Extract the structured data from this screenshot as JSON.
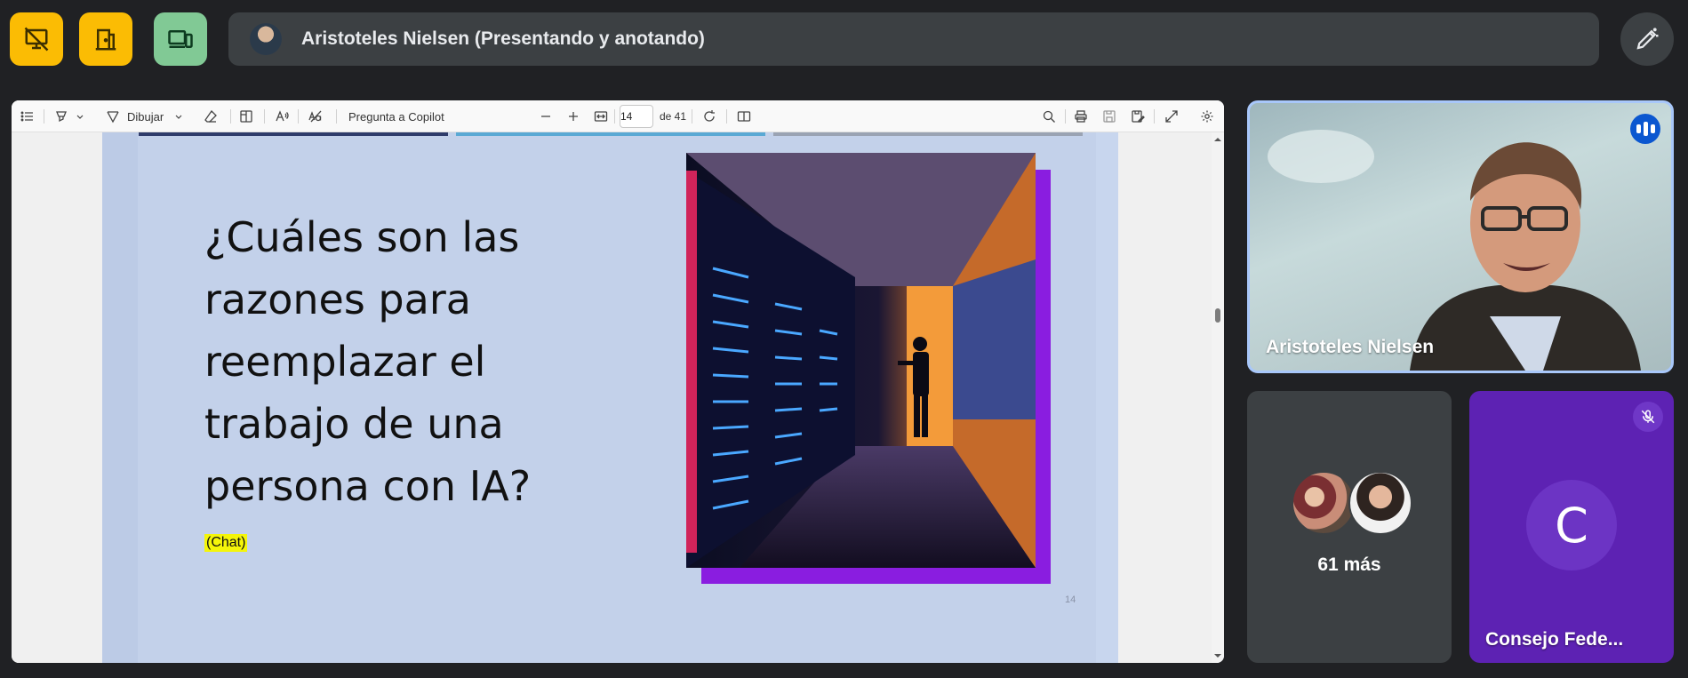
{
  "top_controls": [
    {
      "name": "stop-presenting",
      "color": "#fbbc04"
    },
    {
      "name": "leave-presentation",
      "color": "#fbbc04"
    },
    {
      "name": "switch-device",
      "color": "#81c995"
    }
  ],
  "presenter_bar": {
    "text": "Aristoteles Nielsen (Presentando y anotando)"
  },
  "pdf_toolbar": {
    "draw_label": "Dibujar",
    "copilot_label": "Pregunta a Copilot",
    "page_current": "14",
    "page_total": "de 41"
  },
  "slide": {
    "title": "¿Cuáles son las razones para reemplazar el trabajo de  una persona con IA?",
    "chat_tag": "(Chat)",
    "page_number": "14"
  },
  "participants": {
    "main": {
      "name": "Aristoteles Nielsen"
    },
    "more": {
      "label": "61 más"
    },
    "council": {
      "initial": "C",
      "name": "Consejo Fede..."
    }
  },
  "colors": {
    "accent_blue": "#a8c7fa",
    "yellow": "#fbbc04",
    "green": "#81c995",
    "purple_tile": "#5d22b3"
  }
}
